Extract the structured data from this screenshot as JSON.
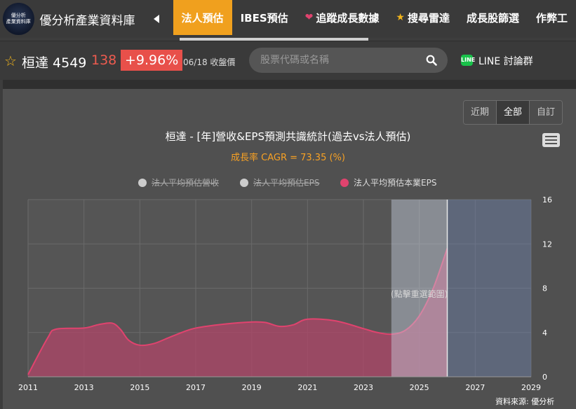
{
  "site": {
    "logo_line1": "優分析",
    "logo_line2": "產業資料庫",
    "title": "優分析產業資料庫"
  },
  "nav": {
    "items": [
      {
        "label": "法人預估",
        "active": true,
        "icon": ""
      },
      {
        "label": "IBES預估",
        "active": false,
        "icon": ""
      },
      {
        "label": "追蹤成長數據",
        "active": false,
        "icon": "heart-icon"
      },
      {
        "label": "搜尋雷達",
        "active": false,
        "icon": "star-icon"
      },
      {
        "label": "成長股篩選",
        "active": false,
        "icon": ""
      },
      {
        "label": "作弊工",
        "active": false,
        "icon": ""
      }
    ]
  },
  "quote": {
    "name": "桓達 4549",
    "price": "138",
    "change": "+9.96%",
    "date_label": "06/18 收盤價",
    "colors": {
      "up": "#ee5b4f",
      "badge": "#e8504a"
    }
  },
  "search": {
    "placeholder": "股票代碼或名稱"
  },
  "line_group": {
    "label": "LINE 討論群"
  },
  "range_buttons": [
    {
      "label": "近期",
      "active": false
    },
    {
      "label": "全部",
      "active": true
    },
    {
      "label": "自訂",
      "active": false
    }
  ],
  "source": "資料來源: 優分析",
  "chart_data": {
    "type": "area",
    "title": "桓達 - [年]營收&EPS預測共識統計(過去vs法人預估)",
    "subtitle": "成長率 CAGR = 73.35 (%)",
    "legend": [
      {
        "name": "法人平均預估營收",
        "hidden": true,
        "color": "#cccccc"
      },
      {
        "name": "法人平均預估EPS",
        "hidden": true,
        "color": "#cccccc"
      },
      {
        "name": "法人平均預估本業EPS",
        "hidden": false,
        "color": "#e0436e"
      }
    ],
    "x_ticks": [
      2011,
      2013,
      2015,
      2017,
      2019,
      2021,
      2023,
      2025,
      2027,
      2029
    ],
    "xlim": [
      2011,
      2029
    ],
    "y_ticks": [
      0,
      4,
      8,
      12,
      16
    ],
    "ylim": [
      0,
      16
    ],
    "y_axis_side": "right",
    "grid": true,
    "series": [
      {
        "name": "法人平均預估本業EPS",
        "color": "#e0436e",
        "x": [
          2011,
          2011.7,
          2012,
          2013,
          2013.5,
          2014,
          2014.3,
          2014.6,
          2015,
          2015.5,
          2016,
          2016.5,
          2017,
          2018,
          2019,
          2019.5,
          2020,
          2020.5,
          2021,
          2022,
          2023,
          2023.5,
          2024,
          2024.5,
          2025,
          2025.5,
          2026
        ],
        "values": [
          0.2,
          3.5,
          4.3,
          4.4,
          4.7,
          4.85,
          4.3,
          3.3,
          2.85,
          3.0,
          3.5,
          4.0,
          4.4,
          4.75,
          4.95,
          4.9,
          4.55,
          4.7,
          5.2,
          5.05,
          4.35,
          4.0,
          3.85,
          4.2,
          5.5,
          8.0,
          11.6
        ]
      }
    ],
    "bands": [
      {
        "from": 2024,
        "to": 2026,
        "color": "#c8d0e0",
        "opacity": 0.45
      },
      {
        "from": 2026,
        "to": 2029,
        "color": "#6b7fa8",
        "opacity": 0.45
      }
    ],
    "band_label": "(點擊重選範圍)"
  }
}
